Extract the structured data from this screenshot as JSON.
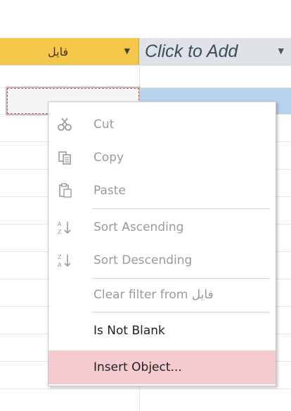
{
  "table": {
    "field_header": "فايل",
    "add_header": "Click to Add"
  },
  "menu": {
    "items": [
      {
        "key": "cut",
        "label": "Cut",
        "enabled": false
      },
      {
        "key": "copy",
        "label": "Copy",
        "enabled": false
      },
      {
        "key": "paste",
        "label": "Paste",
        "enabled": false
      },
      {
        "key": "sort-ascending",
        "label": "Sort Ascending",
        "enabled": false
      },
      {
        "key": "sort-descending",
        "label": "Sort Descending",
        "enabled": false
      },
      {
        "key": "clear-filter",
        "label": "Clear filter from فايل",
        "enabled": false
      },
      {
        "key": "is-not-blank",
        "label": "Is Not Blank",
        "enabled": true
      },
      {
        "key": "insert-object",
        "label": "Insert Object...",
        "enabled": true,
        "highlighted": true
      }
    ]
  },
  "colors": {
    "field_header_bg": "#f3c84a",
    "add_header_bg": "#dfe3e8",
    "selected_row_blue": "#b9d2ef",
    "menu_highlight": "#f5cbcf",
    "disabled_text": "#9a9a9a",
    "enabled_text": "#1f1f1f"
  },
  "icons": {
    "cut": "scissors-icon",
    "copy": "copy-icon",
    "paste": "paste-icon",
    "sort_ascending": "sort-ascending-icon",
    "sort_descending": "sort-descending-icon",
    "dropdown": "chevron-down-icon"
  }
}
